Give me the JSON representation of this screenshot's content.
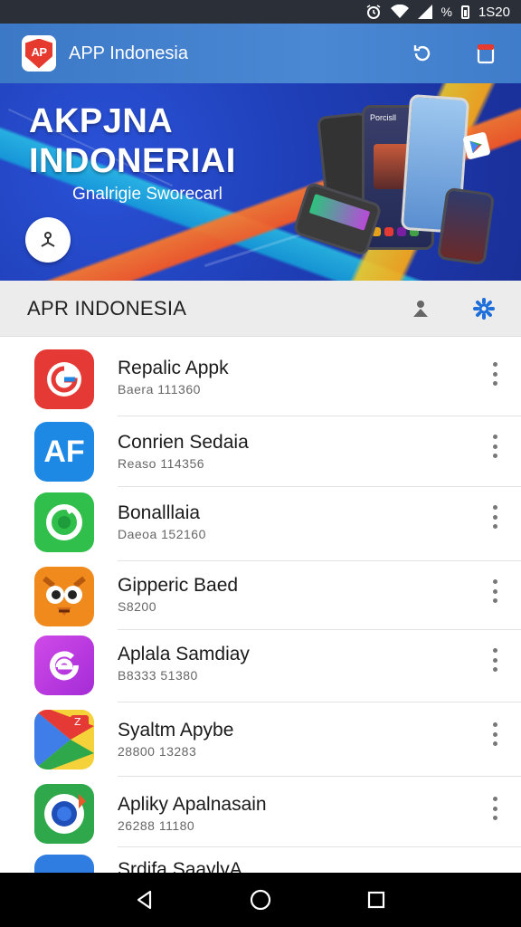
{
  "status_bar": {
    "time": "1S20",
    "icons": [
      "alarm-icon",
      "wifi-icon",
      "signal-icon",
      "battery-icon"
    ],
    "signal_text": "%"
  },
  "app_bar": {
    "logo_text": "AP",
    "title": "APP Indonesia",
    "actions": [
      "refresh-icon",
      "share-icon"
    ]
  },
  "banner": {
    "title_line1": "AKPJNA",
    "title_line2": "INDONERIAI",
    "subtitle": "Gnalrigie Sworecarl",
    "device_screen_text": "Porcisll"
  },
  "section": {
    "title": "APR INDONESIA",
    "actions": [
      "user-pin-icon",
      "settings-icon"
    ]
  },
  "apps": [
    {
      "name": "Repalic Appk",
      "meta": "Baera 111360",
      "icon": "g-logo-icon",
      "icon_bg": "#e53935"
    },
    {
      "name": "Conrien Sedaia",
      "meta": "Reaso 114356",
      "icon": "af-icon",
      "icon_bg": "#1e88e5",
      "icon_text": "AF"
    },
    {
      "name": "Bonalllaia",
      "meta": "Daeoa 152160",
      "icon": "green-swirl-icon",
      "icon_bg": "#2fbf4a"
    },
    {
      "name": "Gipperic Baed",
      "meta": "S8200",
      "icon": "owl-icon",
      "icon_bg": "#f08a1c"
    },
    {
      "name": "Aplala Samdiay",
      "meta": "B8333 51380",
      "icon": "purple-e-icon",
      "icon_bg": "#c03be0"
    },
    {
      "name": "Syaltm Apybe",
      "meta": "28800 13283",
      "icon": "play-store-icon",
      "icon_bg": "#f6d23a"
    },
    {
      "name": "Apliky Apalnasain",
      "meta": "26288 11180",
      "icon": "browser-icon",
      "icon_bg": "#2ea84a"
    },
    {
      "name": "Srdifa SaaylyA",
      "meta": "",
      "icon": "blue-app-icon",
      "icon_bg": "#2f7de0"
    }
  ],
  "nav_bar": {
    "buttons": [
      "back-icon",
      "home-icon",
      "recents-icon"
    ]
  },
  "colors": {
    "app_bar": "#4a88d4",
    "banner": "#1f3fb8",
    "section_bg": "#ececec",
    "accent": "#1e6fd9"
  }
}
